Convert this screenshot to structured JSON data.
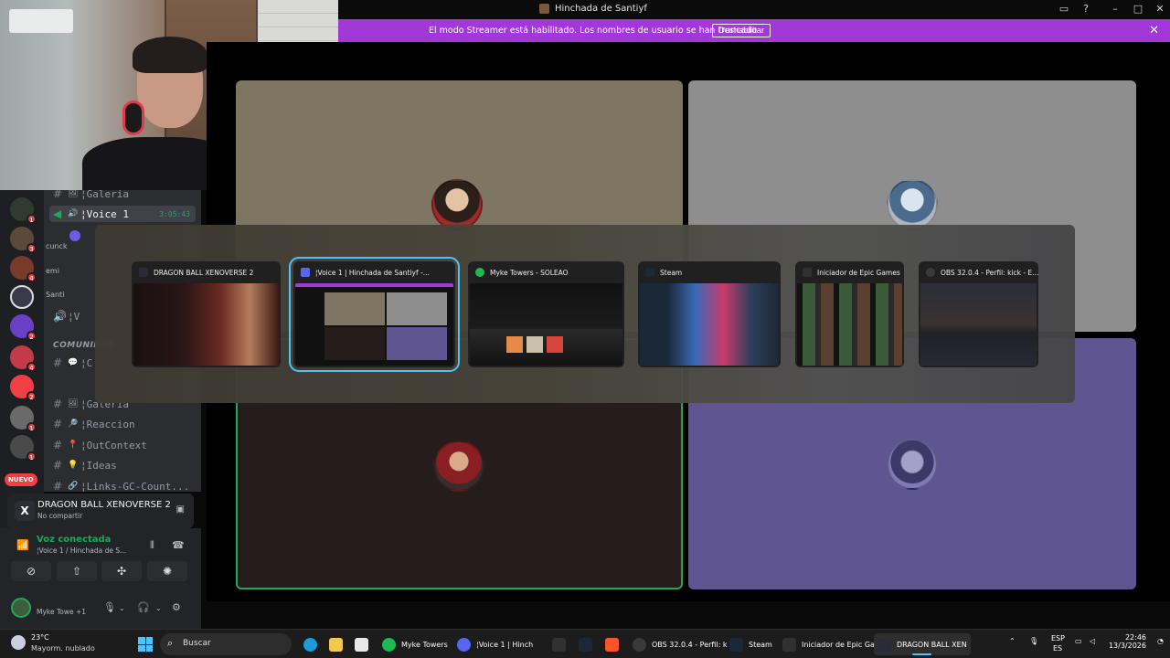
{
  "window": {
    "title": "Hinchada de Santiyf",
    "controls": [
      "inbox-icon",
      "help-icon",
      "minimize-icon",
      "maximize-icon",
      "close-icon"
    ]
  },
  "streamer_banner": {
    "message": "El modo Streamer está habilitado. Los nombres de usuario se han truncado.",
    "button": "Deshabilitar",
    "color": "#a238d8"
  },
  "channels": {
    "items": [
      {
        "emoji": "🖼",
        "name": "¦Galeria"
      },
      {
        "emoji": "🔊",
        "name": "¦Voice 1",
        "time": "3:05:43",
        "active": true
      },
      {
        "emoji": "🔊",
        "name": "¦V"
      },
      {
        "emoji": "💬",
        "name": "¦C"
      },
      {
        "emoji": "🖼",
        "name": "¦Galeria"
      },
      {
        "emoji": "🔎",
        "name": "¦Reaccion"
      },
      {
        "emoji": "📍",
        "name": "¦OutContext"
      },
      {
        "emoji": "💡",
        "name": "¦Ideas"
      },
      {
        "emoji": "🔗",
        "name": "¦Links-GC-Count..."
      }
    ],
    "category": "COMUNIDAD",
    "voice_users": [
      "cunck",
      "emi",
      "Santi"
    ],
    "partial": [
      "Sa",
      "iE"
    ]
  },
  "rail": {
    "badges": [
      "1",
      "3",
      "4",
      "",
      "2",
      "4",
      "2",
      "1",
      "1"
    ],
    "new_label": "NUEVO"
  },
  "activity": {
    "game": "DRAGON BALL XENOVERSE 2",
    "status": "No compartir"
  },
  "voice_panel": {
    "title": "Voz conectada",
    "subtitle": "¦Voice 1 / Hinchada de S...",
    "user": "Myke Towe +1"
  },
  "switcher": {
    "windows": [
      {
        "title": "DRAGON BALL XENOVERSE 2",
        "icon_color": "#2a2a38"
      },
      {
        "title": "¦Voice 1 | Hinchada de Santiyf -...",
        "icon_color": "#5865f2",
        "selected": true
      },
      {
        "title": "Myke Towers - SOLEAO",
        "icon_color": "#1db954"
      },
      {
        "title": "Steam",
        "icon_color": "#1b2838"
      },
      {
        "title": "Iniciador de Epic Games",
        "icon_color": "#313131"
      },
      {
        "title": "OBS 32.0.4 - Perfil: kick - E...",
        "icon_color": "#3a3a3a"
      }
    ]
  },
  "taskbar": {
    "weather": {
      "temp": "23°C",
      "condition": "Mayorm. nublado"
    },
    "search_placeholder": "Buscar",
    "apps": [
      {
        "label": "Myke Towers",
        "color": "#1db954"
      },
      {
        "label": "¦Voice 1 | Hinch",
        "color": "#5865f2"
      },
      {
        "label": "",
        "color": "#313131"
      },
      {
        "label": "",
        "color": "#1b2838"
      },
      {
        "label": "",
        "color": "#fb542b"
      },
      {
        "label": "OBS 32.0.4 - Perfil: k",
        "color": "#3a3a3a"
      },
      {
        "label": "Steam",
        "color": "#1b2838"
      },
      {
        "label": "Iniciador de Epic Ga",
        "color": "#313131"
      },
      {
        "label": "DRAGON BALL XEN",
        "color": "#2a2a38",
        "active": true
      }
    ],
    "lang": "ESP",
    "lang2": "ES",
    "time": "22:46",
    "date": "13/3/2026"
  }
}
